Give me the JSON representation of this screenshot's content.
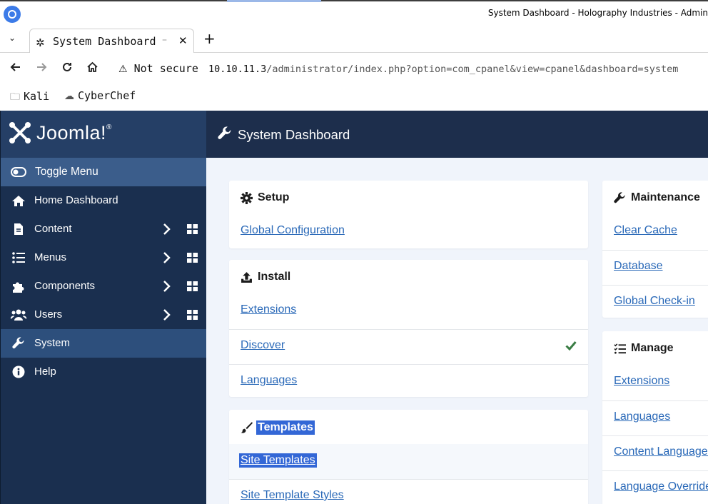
{
  "browser": {
    "window_title": "System Dashboard - Holography Industries - Admin",
    "tab_title": "System Dashboard",
    "tab_dash": "–",
    "tab_close": "✕",
    "new_tab": "+",
    "tab_list": "⌄",
    "security_label": "Not secure",
    "url_host": "10.10.11.3",
    "url_path": "/administrator/index.php?option=com_cpanel&view=cpanel&dashboard=system",
    "bookmarks": [
      {
        "label": "Kali",
        "icon": "folder-icon"
      },
      {
        "label": "CyberChef",
        "icon": "chef-hat-icon"
      }
    ]
  },
  "brand": {
    "name": "Joomla!"
  },
  "sidebar": {
    "toggle_label": "Toggle Menu",
    "items": [
      {
        "label": "Home Dashboard",
        "icon": "home-icon"
      },
      {
        "label": "Content",
        "icon": "file-icon"
      },
      {
        "label": "Menus",
        "icon": "list-icon"
      },
      {
        "label": "Components",
        "icon": "puzzle-icon"
      },
      {
        "label": "Users",
        "icon": "users-icon"
      },
      {
        "label": "System",
        "icon": "wrench-icon"
      },
      {
        "label": "Help",
        "icon": "info-icon"
      }
    ]
  },
  "header": {
    "title": "System Dashboard"
  },
  "cards": {
    "setup": {
      "title": "Setup",
      "links": [
        "Global Configuration"
      ]
    },
    "install": {
      "title": "Install",
      "links": [
        "Extensions",
        "Discover",
        "Languages"
      ]
    },
    "templates": {
      "title": "Templates",
      "links": [
        "Site Templates",
        "Site Template Styles"
      ]
    },
    "maintenance": {
      "title": "Maintenance",
      "links": [
        "Clear Cache",
        "Database",
        "Global Check-in"
      ]
    },
    "manage": {
      "title": "Manage",
      "links": [
        "Extensions",
        "Languages",
        "Content Languages",
        "Language Overrides"
      ]
    }
  },
  "colors": {
    "sidebar_bg": "#1a2f4f",
    "header_bg": "#1d2e4c",
    "link": "#2a69b8",
    "selection": "#3367d6",
    "check": "#3a7d44"
  }
}
